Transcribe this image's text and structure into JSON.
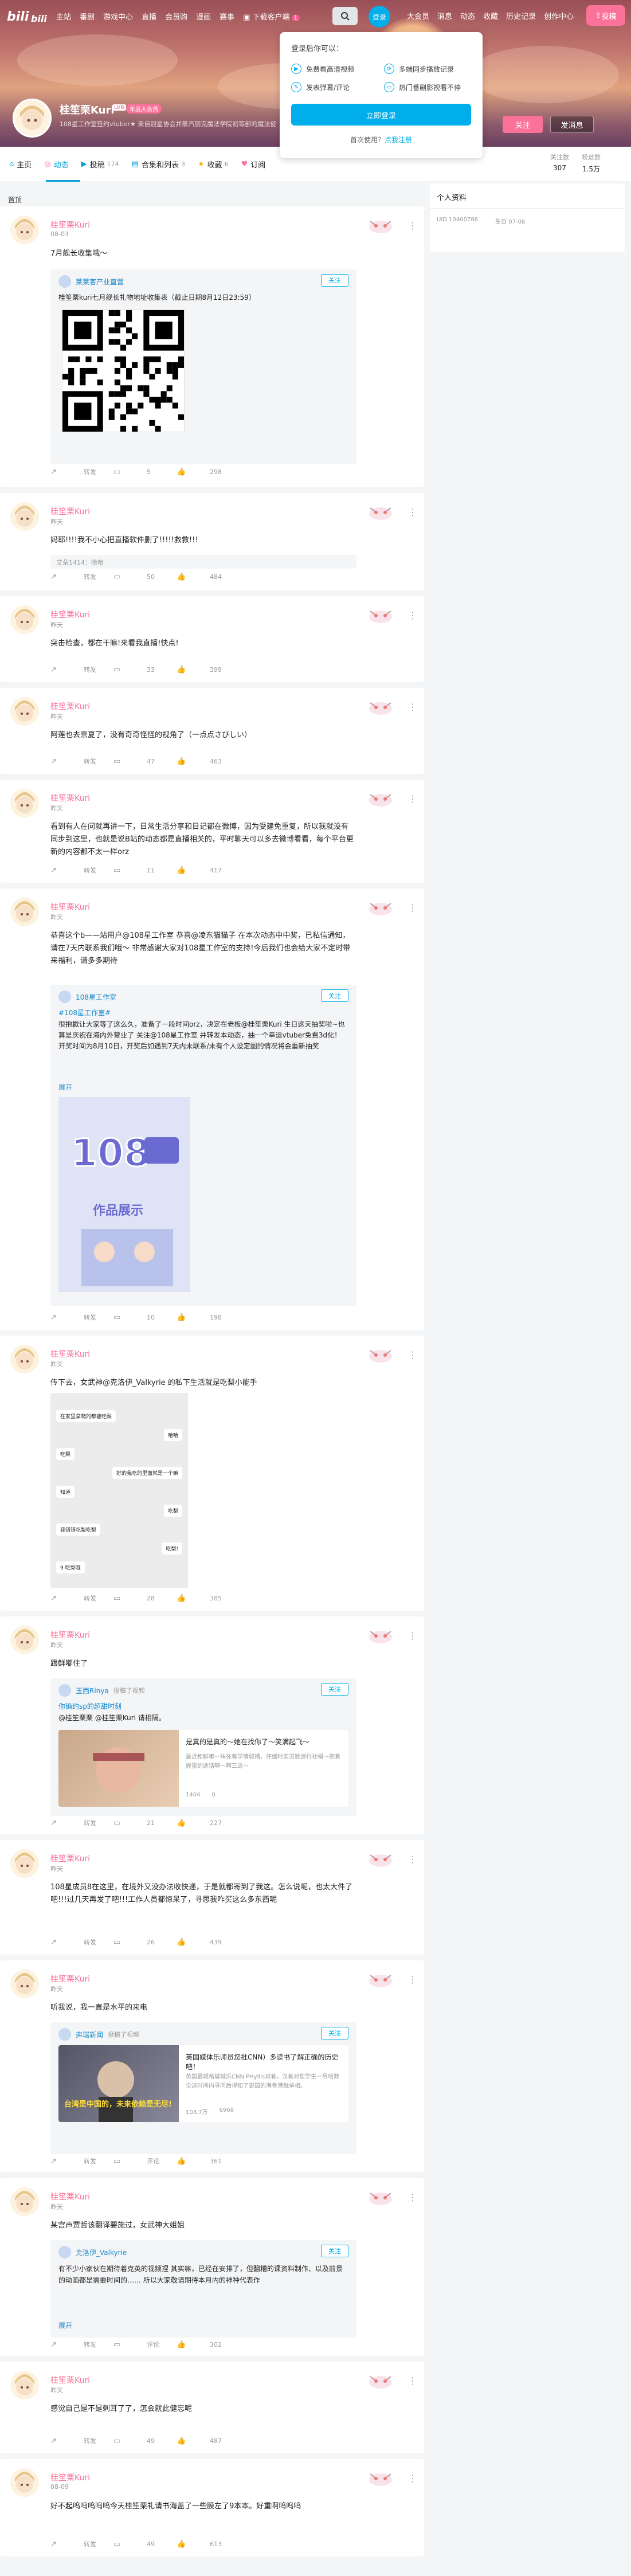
{
  "topbar": {
    "nav_left": [
      "主站",
      "番剧",
      "游戏中心",
      "直播",
      "会员购",
      "漫画",
      "赛事"
    ],
    "download": "下载客户端",
    "download_badge": "1",
    "login": "登录",
    "nav_right": [
      "大会员",
      "消息",
      "动态",
      "收藏",
      "历史记录",
      "创作中心"
    ],
    "upload": "投稿"
  },
  "login_popup": {
    "title": "登录后你可以：",
    "features": [
      "免费看高清视频",
      "多端同步播放记录",
      "发表弹幕/评论",
      "热门番剧影视看不停"
    ],
    "login_button": "立即登录",
    "register_prompt": "首次使用？",
    "register_link": "点我注册"
  },
  "profile": {
    "name": "桂笙栗Kuri",
    "level": "LV6",
    "vip": "年度大会员",
    "sign": "108星工作室签约vtuber★ 来自冠星协会并蒸汽朋克魔法学院初等部的魔法使",
    "follow": "关注",
    "message": "发消息",
    "stats": [
      {
        "label": "关注数",
        "value": "307"
      },
      {
        "label": "粉丝数",
        "value": "1.5万"
      }
    ]
  },
  "tabs": [
    {
      "label": "主页",
      "count": ""
    },
    {
      "label": "动态",
      "count": ""
    },
    {
      "label": "投稿",
      "count": "174"
    },
    {
      "label": "合集和列表",
      "count": "3"
    },
    {
      "label": "收藏",
      "count": "6"
    },
    {
      "label": "订阅",
      "count": ""
    }
  ],
  "section_label": "置顶",
  "side_panel": {
    "title": "个人资料",
    "uid": "UID 10400786",
    "birthday": "生日 07-08"
  },
  "posts": [
    {
      "name": "桂笙栗Kuri",
      "date": "08-03",
      "text": "7月舰长收集哦～",
      "repost": {
        "author": "莱莱客产业直营",
        "follow": "关注",
        "text": "桂笙栗kuri七月舰长礼物地址收集表（截止日期8月12日23:59）"
      },
      "actions": [
        "转发",
        "5",
        "298"
      ]
    },
    {
      "name": "桂笙栗Kuri",
      "date": "昨天",
      "text": "妈耶!!!!我不小心把直播软件删了!!!!!救救!!!",
      "sub": "艾朵1414：哈哈",
      "actions": [
        "转发",
        "50",
        "484"
      ]
    },
    {
      "name": "桂笙栗Kuri",
      "date": "昨天",
      "text": "突击检查，都在干嘛!来看我直播!快点!",
      "actions": [
        "转发",
        "33",
        "399"
      ]
    },
    {
      "name": "桂笙栗Kuri",
      "date": "昨天",
      "text": "阿莲也去京夏了，没有奇奇怪怪的视角了（一点点さびしい）",
      "actions": [
        "转发",
        "47",
        "463"
      ]
    },
    {
      "name": "桂笙栗Kuri",
      "date": "昨天",
      "text": "看到有人在问就再讲一下，日常生活分享和日记都在微博，因为受建免重复，所以我就没有同步到这里，也就是说B站的动态都是直播相关的，平时聊天可以多去微博看看，每个平台更新的内容都不太一样orz",
      "actions": [
        "转发",
        "11",
        "417"
      ]
    },
    {
      "name": "桂笙栗Kuri",
      "date": "昨天",
      "text": "恭喜这个b——站用户@108星工作室 恭喜@凌东猫猫子 在本次动态中中奖，已私信通知，请在7天内联系我们哦～ 非常感谢大家对108星工作室的支持!今后我们也会给大家不定时带来福利，请多多期待",
      "repost": {
        "author": "108星工作室",
        "follow": "关注",
        "tag": "#108星工作室#",
        "text": "很抱歉让大家等了这么久，准备了一段时间orz，决定在老板@桂笙栗Kuri 生日这天抽奖啦~也算是庆祝在海内外营业了 关注@108星工作室 并转发本动态，抽一个幸运vtuber免费3d化！ 开奖时间为8月10日，开奖后如遇到7天内未联系/未有个人设定图的情况将会重新抽奖",
        "more": "展开",
        "img_text": "作品展示"
      },
      "actions": [
        "转发",
        "10",
        "198"
      ]
    },
    {
      "name": "桂笙栗Kuri",
      "date": "昨天",
      "text": "传下去，女武神@克洛伊_Valkyrie 的私下生活就是吃梨小能手",
      "chat": [
        "在家里拿爬的都能吃梨",
        "哈哈",
        "吃梨",
        "好的我吃的里面就是一个嘛",
        "知道",
        "吃梨",
        "我错错吃梨吃梨",
        "吃梨!",
        "9 吃梨哦"
      ],
      "actions": [
        "转发",
        "28",
        "385"
      ]
    },
    {
      "name": "桂笙栗Kuri",
      "date": "昨天",
      "text": "跟鲜嘟住了",
      "repost": {
        "author": "玉西Rinya",
        "author_sub": "投稿了视频",
        "follow": "关注",
        "tag": "你确约sp的超甜时刻",
        "text": "@桂笙栗栗 @桂笙栗Kuri 请相隔。",
        "video_title": "是真的是真的～她在找你了～笑满起飞～",
        "video_desc": "最近和鲜嘟一块在看学情城播，仔细地实况数运行社帽～挖着握里的适话啊～啊三这～",
        "video_stats": [
          "1404",
          "0"
        ]
      },
      "actions": [
        "转发",
        "21",
        "227"
      ]
    },
    {
      "name": "桂笙栗Kuri",
      "date": "昨天",
      "text": "108星成员8在这里，在境外又没办法收快递，于是就都寄到了我这。怎么说呢，也太大件了吧!!!过几天再发了吧!!!工作人员都惊呆了，寻思我咋买这么多东西呢",
      "actions": [
        "转发",
        "26",
        "439"
      ]
    },
    {
      "name": "桂笙栗Kuri",
      "date": "昨天",
      "text": "听我说，我一直是水平的来电",
      "repost": {
        "author": "弗瑞新闻",
        "author_sub": "投稿了视频",
        "follow": "关注",
        "video_title": "英国媒体乐师员您批CNN）多读书了解正确的历史吧！",
        "video_desc": "英国最城格城城乐CNN PHyllis对着，汉着对您学生一尽哈数全选时间内寻问后得知了更国的海香港就单相。",
        "video_stats": [
          "103.7万",
          "6968"
        ],
        "img_label": "台湾是中国的，未来依赖是无尽!"
      },
      "actions": [
        "转发",
        "评论",
        "361"
      ]
    },
    {
      "name": "桂笙栗Kuri",
      "date": "昨天",
      "text": "某宫声贾哲该翻译要施过，女武神大姐姐",
      "repost": {
        "author": "克洛伊_Valkyrie",
        "follow": "关注",
        "text": "有不少小家伙在期待着克英的视频捏 其实嘛，已经在安排了，但翻糟的课资料制作、以及前景的动画都是需要时间的…… 所以大家敬请期待本月内的神种代表作",
        "more": "展开"
      },
      "actions": [
        "转发",
        "评论",
        "302"
      ]
    },
    {
      "name": "桂笙栗Kuri",
      "date": "昨天",
      "text": "感觉自己是不是刺耳了了，怎会就此健忘呢",
      "actions": [
        "转发",
        "49",
        "487"
      ]
    },
    {
      "name": "桂笙栗Kuri",
      "date": "08-09",
      "text": "好不起呜呜呜呜呜今天桂笙栗礼请书海盖了一些膜左了9本本。好重啊呜呜呜",
      "actions": [
        "转发",
        "49",
        "613"
      ]
    }
  ],
  "colors": {
    "accent": "#00aeec",
    "pink": "#fb7299"
  }
}
